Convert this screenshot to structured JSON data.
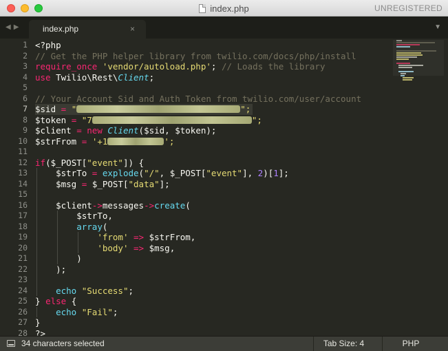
{
  "window": {
    "title": "index.php",
    "registration_status": "UNREGISTERED"
  },
  "tabs": [
    {
      "label": "index.php",
      "close_glyph": "×",
      "active": true
    }
  ],
  "nav": {
    "back_glyph": "◀",
    "forward_glyph": "▶",
    "dropdown_glyph": "▼"
  },
  "editor": {
    "line_numbers": [
      "1",
      "2",
      "3",
      "4",
      "5",
      "6",
      "7",
      "8",
      "9",
      "10",
      "11",
      "12",
      "13",
      "14",
      "15",
      "16",
      "17",
      "18",
      "19",
      "20",
      "21",
      "22",
      "23",
      "24",
      "25",
      "26",
      "27",
      "28"
    ],
    "active_line": 7,
    "code": {
      "l1": "<?php",
      "l2": "// Get the PHP helper library from twilio.com/docs/php/install",
      "l3_kw": "require_once",
      "l3_str": "'vendor/autoload.php'",
      "l3_semi": ";",
      "l3_cm": "// Loads the library",
      "l4_kw": "use",
      "l4_ns": "Twilio\\Rest\\",
      "l4_cl": "Client",
      "l4_semi": ";",
      "l6": "// Your Account Sid and Auth Token from twilio.com/user/account",
      "l7_var": "$sid",
      "l7_eq": "=",
      "l7_q1": "\"",
      "l7_q2": "\";",
      "l8_var": "$token",
      "l8_eq": "=",
      "l8_q1": "\"7",
      "l8_q2": "\";",
      "l9_var": "$client",
      "l9_eq": "=",
      "l9_new": "new",
      "l9_cl": "Client",
      "l9_args": "($sid, $token);",
      "l10_var": "$strFrom",
      "l10_eq": "=",
      "l10_q1": "'+1",
      "l10_q2": "';",
      "l12_if": "if",
      "l12_open": "($_POST[",
      "l12_str": "\"event\"",
      "l12_close": "]) {",
      "l13_var": "$strTo",
      "l13_eq": "=",
      "l13_fn": "explode",
      "l13_p1": "(",
      "l13_s1": "\"/\"",
      "l13_p2": ", $_POST[",
      "l13_s2": "\"event\"",
      "l13_p3": "], ",
      "l13_n1": "2",
      "l13_p4": ")[",
      "l13_n2": "1",
      "l13_p5": "];",
      "l14_var": "$msg",
      "l14_eq": "=",
      "l14_p1": "$_POST[",
      "l14_s1": "\"data\"",
      "l14_p2": "];",
      "l16_var": "$client",
      "l16_arrow1": "->",
      "l16_prop": "messages",
      "l16_arrow2": "->",
      "l16_fn": "create",
      "l16_paren": "(",
      "l17": "$strTo,",
      "l18_fn": "array",
      "l18_paren": "(",
      "l19_key": "'from'",
      "l19_arrow": "=>",
      "l19_val": "$strFrom,",
      "l20_key": "'body'",
      "l20_arrow": "=>",
      "l20_val": "$msg,",
      "l21": ")",
      "l22": ");",
      "l24_fn": "echo",
      "l24_str": "\"Success\"",
      "l24_semi": ";",
      "l25_open": "} ",
      "l25_kw": "else",
      "l25_brace": " {",
      "l26_fn": "echo",
      "l26_str": "\"Fail\"",
      "l26_semi": ";",
      "l27": "}",
      "l28": "?>"
    }
  },
  "status_bar": {
    "selection": "34 characters selected",
    "tab_size": "Tab Size: 4",
    "syntax": "PHP"
  },
  "colors": {
    "background": "#272822",
    "comment": "#75715e",
    "keyword": "#f92672",
    "string": "#e6db74",
    "function": "#66d9ef",
    "number": "#ae81ff",
    "text": "#f8f8f2"
  }
}
